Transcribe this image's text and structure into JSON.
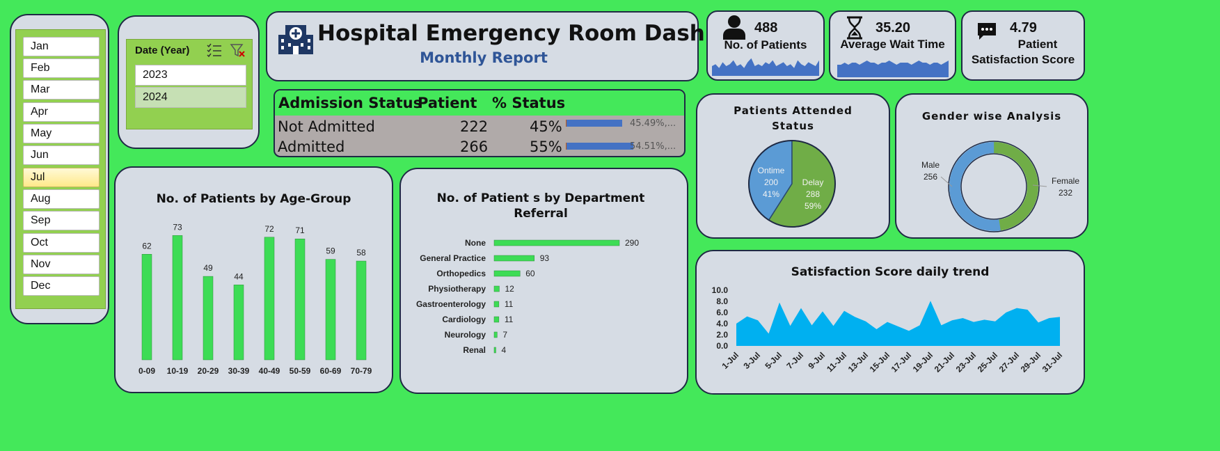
{
  "header": {
    "title": "Hospital Emergency Room Dashboard",
    "subtitle": "Monthly Report"
  },
  "months": {
    "items": [
      "Jan",
      "Feb",
      "Mar",
      "Apr",
      "May",
      "Jun",
      "Jul",
      "Aug",
      "Sep",
      "Oct",
      "Nov",
      "Dec"
    ],
    "selected": "Jul"
  },
  "year_slicer": {
    "title": "Date (Year)",
    "items": [
      "2023",
      "2024"
    ],
    "selected": "2024"
  },
  "kpis": {
    "patients": {
      "value": "488",
      "label": "No. of Patients",
      "spark": [
        5,
        6,
        4,
        7,
        5,
        6,
        8,
        5,
        6,
        4,
        7,
        9,
        5,
        6,
        5,
        7,
        6,
        8,
        5,
        6,
        7,
        5,
        6,
        4,
        8,
        6,
        5,
        7,
        6,
        5,
        8
      ]
    },
    "wait": {
      "value": "35.20",
      "label": "Average Wait Time",
      "spark": [
        6,
        6,
        7,
        6,
        7,
        7,
        6,
        7,
        8,
        7,
        7,
        6,
        7,
        7,
        8,
        7,
        6,
        7,
        7,
        7,
        6,
        7,
        8,
        7,
        7,
        6,
        7,
        7,
        6,
        7,
        8
      ]
    },
    "satisfaction": {
      "value": "4.79",
      "label_line1": "Patient",
      "label_line2": "Satisfaction Score"
    }
  },
  "admission_table": {
    "headers": [
      "Admission Status",
      "Patient",
      "% Status"
    ],
    "rows": [
      {
        "status": "Not Admitted",
        "patients": "222",
        "pct": "45%",
        "bar_label": "45.49%,...",
        "bar": 0.4549
      },
      {
        "status": "Admitted",
        "patients": "266",
        "pct": "55%",
        "bar_label": "54.51%,...",
        "bar": 0.5451
      }
    ]
  },
  "colors": {
    "green_bar": "#3ddc55",
    "blue": "#5b9bd5",
    "green_pie": "#70ad47",
    "area": "#00b0f0",
    "panel": "#d6dce4",
    "border": "#1f2a44"
  },
  "chart_data": [
    {
      "type": "bar",
      "title": "No. of Patients by Age-Group",
      "categories": [
        "0-09",
        "10-19",
        "20-29",
        "30-39",
        "40-49",
        "50-59",
        "60-69",
        "70-79"
      ],
      "values": [
        62,
        73,
        49,
        44,
        72,
        71,
        59,
        58
      ],
      "ylim": [
        0,
        80
      ]
    },
    {
      "type": "bar",
      "orientation": "horizontal",
      "title_line1": "No. of Patient s by Department",
      "title_line2": "Referral",
      "categories": [
        "None",
        "General Practice",
        "Orthopedics",
        "Physiotherapy",
        "Gastroenterology",
        "Cardiology",
        "Neurology",
        "Renal"
      ],
      "values": [
        290,
        93,
        60,
        12,
        11,
        11,
        7,
        4
      ],
      "xlim": [
        0,
        300
      ]
    },
    {
      "type": "pie",
      "title_line1": "Patients Attended",
      "title_line2": "Status",
      "slices": [
        {
          "name": "Ontime",
          "value": 200,
          "pct": "41%"
        },
        {
          "name": "Delay",
          "value": 288,
          "pct": "59%"
        }
      ]
    },
    {
      "type": "pie",
      "donut": true,
      "title": "Gender wise Analysis",
      "slices": [
        {
          "name": "Male",
          "value": 256
        },
        {
          "name": "Female",
          "value": 232
        }
      ]
    },
    {
      "type": "area",
      "title": "Satisfaction Score daily trend",
      "x": [
        "1-Jul",
        "2-Jul",
        "3-Jul",
        "4-Jul",
        "5-Jul",
        "6-Jul",
        "7-Jul",
        "8-Jul",
        "9-Jul",
        "10-Jul",
        "11-Jul",
        "12-Jul",
        "13-Jul",
        "14-Jul",
        "15-Jul",
        "16-Jul",
        "17-Jul",
        "18-Jul",
        "19-Jul",
        "20-Jul",
        "21-Jul",
        "22-Jul",
        "23-Jul",
        "24-Jul",
        "25-Jul",
        "26-Jul",
        "27-Jul",
        "28-Jul",
        "29-Jul",
        "30-Jul",
        "31-Jul"
      ],
      "tick_labels": [
        "1-Jul",
        "3-Jul",
        "5-Jul",
        "7-Jul",
        "9-Jul",
        "11-Jul",
        "13-Jul",
        "15-Jul",
        "17-Jul",
        "19-Jul",
        "21-Jul",
        "23-Jul",
        "25-Jul",
        "27-Jul",
        "29-Jul",
        "31-Jul"
      ],
      "values": [
        4.0,
        5.3,
        4.6,
        2.2,
        7.8,
        3.6,
        6.8,
        3.7,
        6.2,
        3.6,
        6.3,
        5.2,
        4.4,
        3.0,
        4.3,
        3.5,
        2.7,
        3.7,
        8.1,
        3.7,
        4.6,
        5.0,
        4.3,
        4.7,
        4.4,
        6.0,
        6.8,
        6.5,
        4.2,
        5.0,
        5.2
      ],
      "yticks": [
        "0.0",
        "2.0",
        "4.0",
        "6.0",
        "8.0",
        "10.0"
      ],
      "ylim": [
        0,
        10
      ]
    }
  ]
}
